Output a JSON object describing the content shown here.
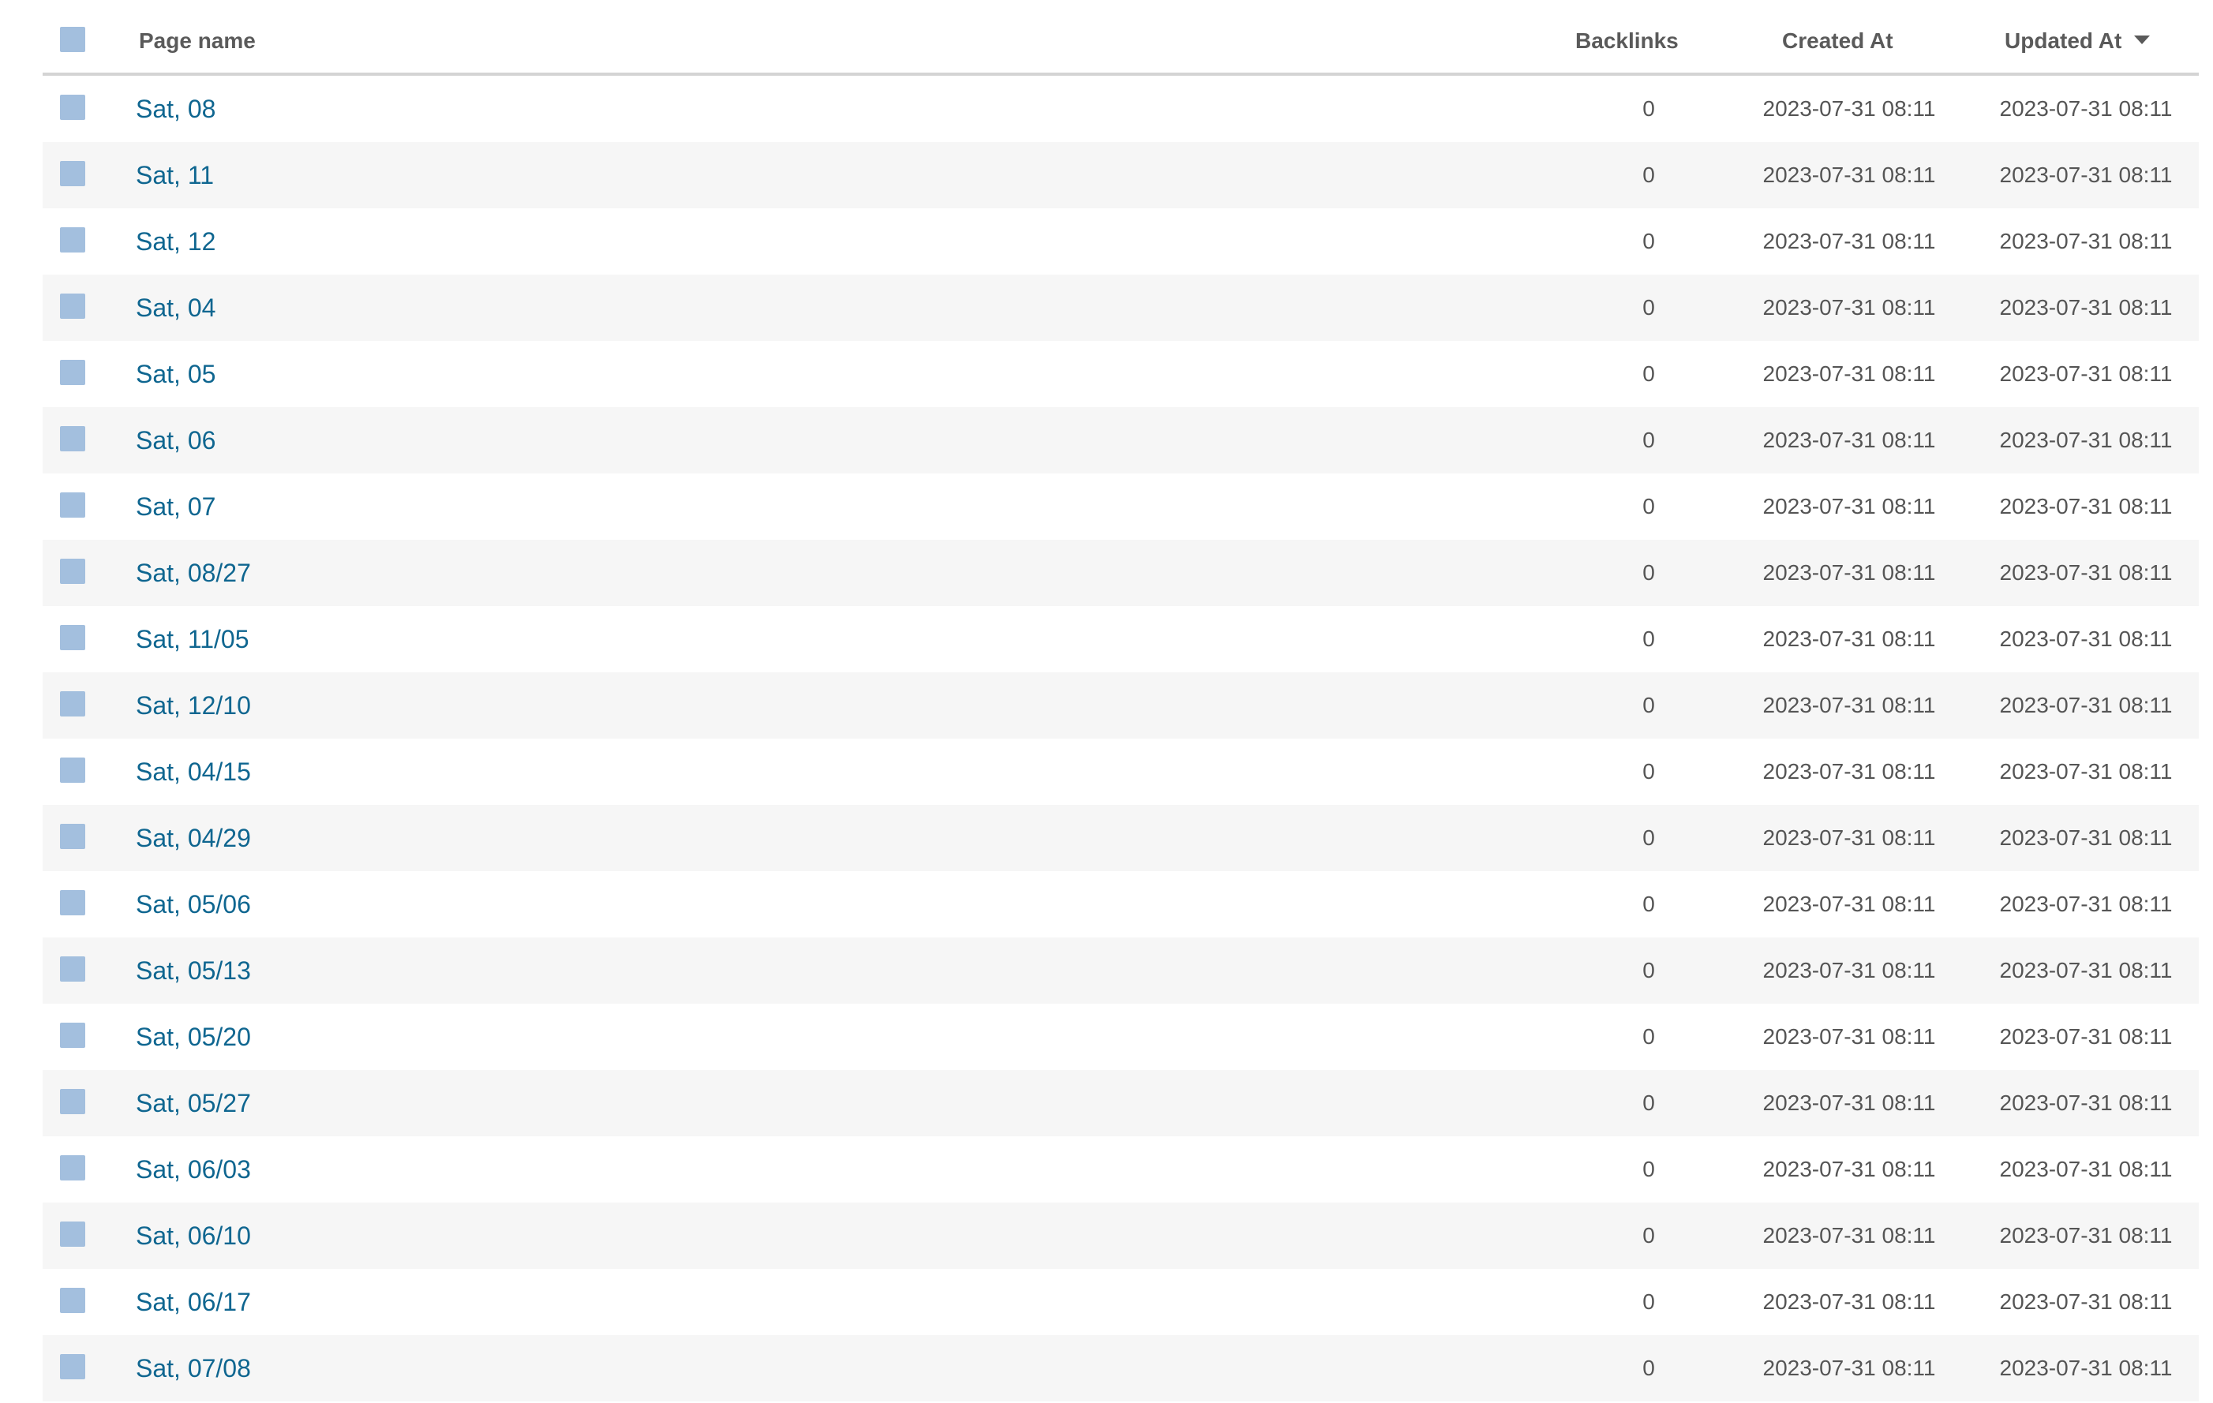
{
  "table": {
    "columns": {
      "page_name": "Page name",
      "backlinks": "Backlinks",
      "created_at": "Created At",
      "updated_at": "Updated At"
    },
    "sort": {
      "column": "Updated At",
      "direction": "descending",
      "icon": "caret-down-icon"
    },
    "checkbox_color": "#a3bfde",
    "link_color": "#0f6690",
    "rows": [
      {
        "name": "Sat, 08",
        "backlinks": "0",
        "created": "2023-07-31 08:11",
        "updated": "2023-07-31 08:11"
      },
      {
        "name": "Sat, 11",
        "backlinks": "0",
        "created": "2023-07-31 08:11",
        "updated": "2023-07-31 08:11"
      },
      {
        "name": "Sat, 12",
        "backlinks": "0",
        "created": "2023-07-31 08:11",
        "updated": "2023-07-31 08:11"
      },
      {
        "name": "Sat, 04",
        "backlinks": "0",
        "created": "2023-07-31 08:11",
        "updated": "2023-07-31 08:11"
      },
      {
        "name": "Sat, 05",
        "backlinks": "0",
        "created": "2023-07-31 08:11",
        "updated": "2023-07-31 08:11"
      },
      {
        "name": "Sat, 06",
        "backlinks": "0",
        "created": "2023-07-31 08:11",
        "updated": "2023-07-31 08:11"
      },
      {
        "name": "Sat, 07",
        "backlinks": "0",
        "created": "2023-07-31 08:11",
        "updated": "2023-07-31 08:11"
      },
      {
        "name": "Sat, 08/27",
        "backlinks": "0",
        "created": "2023-07-31 08:11",
        "updated": "2023-07-31 08:11"
      },
      {
        "name": "Sat, 11/05",
        "backlinks": "0",
        "created": "2023-07-31 08:11",
        "updated": "2023-07-31 08:11"
      },
      {
        "name": "Sat, 12/10",
        "backlinks": "0",
        "created": "2023-07-31 08:11",
        "updated": "2023-07-31 08:11"
      },
      {
        "name": "Sat, 04/15",
        "backlinks": "0",
        "created": "2023-07-31 08:11",
        "updated": "2023-07-31 08:11"
      },
      {
        "name": "Sat, 04/29",
        "backlinks": "0",
        "created": "2023-07-31 08:11",
        "updated": "2023-07-31 08:11"
      },
      {
        "name": "Sat, 05/06",
        "backlinks": "0",
        "created": "2023-07-31 08:11",
        "updated": "2023-07-31 08:11"
      },
      {
        "name": "Sat, 05/13",
        "backlinks": "0",
        "created": "2023-07-31 08:11",
        "updated": "2023-07-31 08:11"
      },
      {
        "name": "Sat, 05/20",
        "backlinks": "0",
        "created": "2023-07-31 08:11",
        "updated": "2023-07-31 08:11"
      },
      {
        "name": "Sat, 05/27",
        "backlinks": "0",
        "created": "2023-07-31 08:11",
        "updated": "2023-07-31 08:11"
      },
      {
        "name": "Sat, 06/03",
        "backlinks": "0",
        "created": "2023-07-31 08:11",
        "updated": "2023-07-31 08:11"
      },
      {
        "name": "Sat, 06/10",
        "backlinks": "0",
        "created": "2023-07-31 08:11",
        "updated": "2023-07-31 08:11"
      },
      {
        "name": "Sat, 06/17",
        "backlinks": "0",
        "created": "2023-07-31 08:11",
        "updated": "2023-07-31 08:11"
      },
      {
        "name": "Sat, 07/08",
        "backlinks": "0",
        "created": "2023-07-31 08:11",
        "updated": "2023-07-31 08:11"
      }
    ]
  }
}
